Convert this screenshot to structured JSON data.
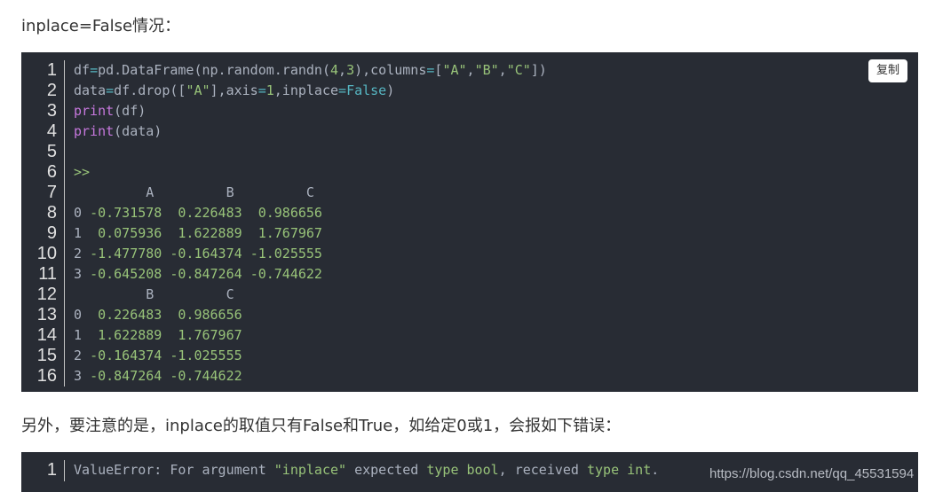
{
  "intro_text": "inplace=False情况：",
  "code_block": {
    "copy_label": "复制",
    "line_numbers": [
      "1",
      "2",
      "3",
      "4",
      "5",
      "6",
      "7",
      "8",
      "9",
      "10",
      "11",
      "12",
      "13",
      "14",
      "15",
      "16"
    ],
    "lines": [
      "df=pd.DataFrame(np.random.randn(4,3),columns=[\"A\",\"B\",\"C\"])",
      "data=df.drop([\"A\"],axis=1,inplace=False)",
      "print(df)",
      "print(data)",
      "",
      ">>",
      "         A         B         C",
      "0 -0.731578  0.226483  0.986656",
      "1  0.075936  1.622889  1.767967",
      "2 -1.477780 -0.164374 -1.025555",
      "3 -0.645208 -0.847264 -0.744622",
      "         B         C",
      "0  0.226483  0.986656",
      "1  1.622889  1.767967",
      "2 -0.164374 -1.025555",
      "3 -0.847264 -0.744622"
    ]
  },
  "middle_text": "另外，要注意的是，inplace的取值只有False和True，如给定0或1，会报如下错误：",
  "error_block": {
    "line_numbers": [
      "1"
    ],
    "lines": [
      "ValueError: For argument \"inplace\" expected type bool, received type int."
    ]
  },
  "watermark": "https://blog.csdn.net/qq_45531594",
  "colors": {
    "code_background": "#282c34",
    "keyword": "#c678dd",
    "string": "#98c379",
    "boolean": "#56b6c2",
    "plain_code": "#abb2bf"
  }
}
